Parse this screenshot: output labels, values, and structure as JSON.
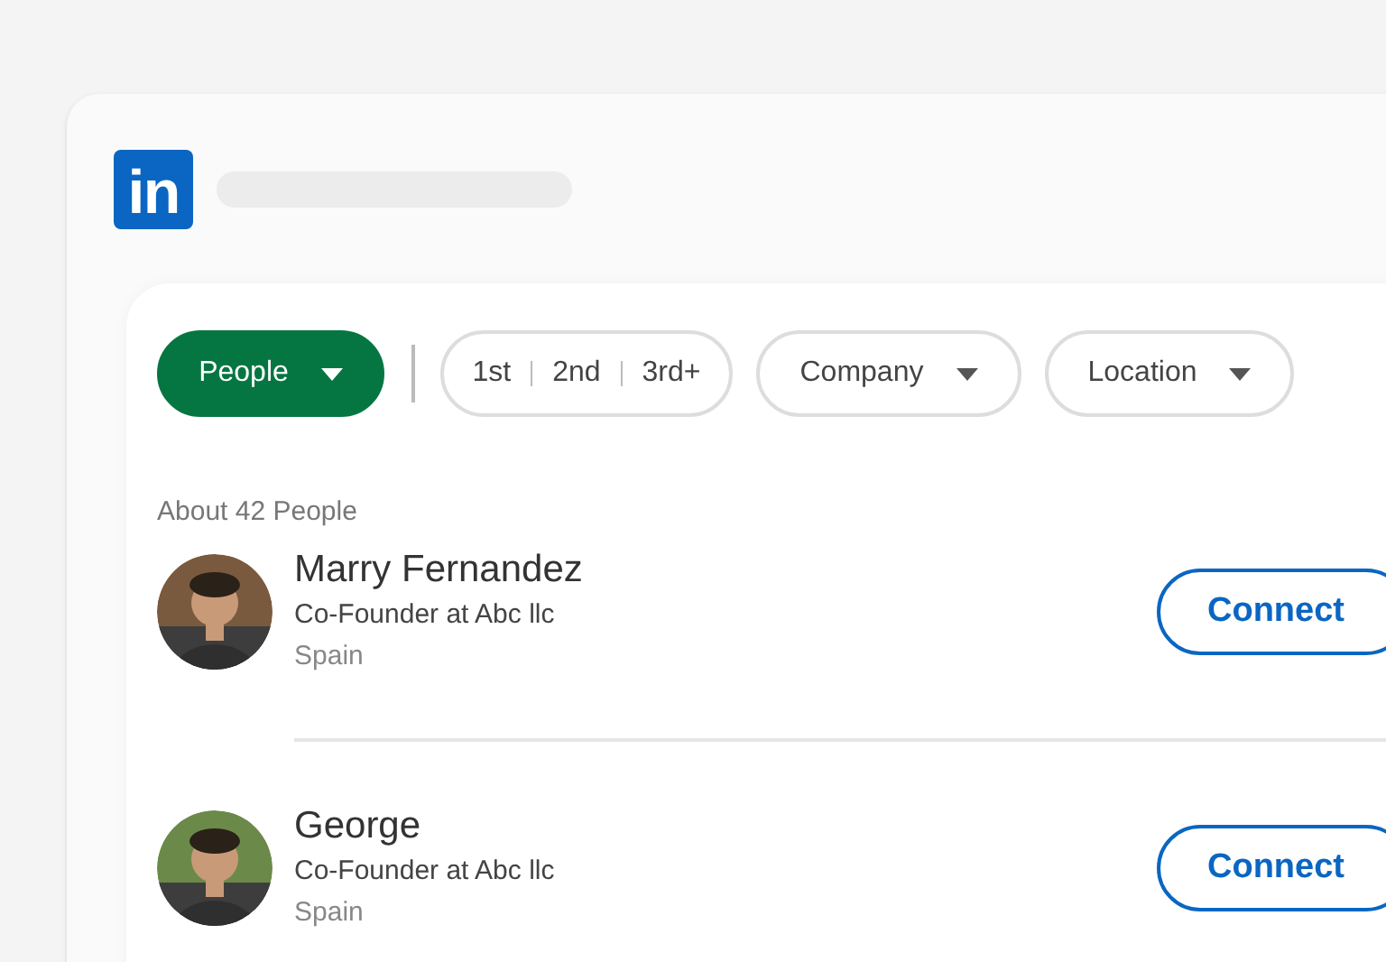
{
  "logo": {
    "text": "in"
  },
  "filters": [
    {
      "kind": "dropdown",
      "label": "People",
      "selected": true
    },
    {
      "kind": "degrees",
      "options": [
        "1st",
        "2nd",
        "3rd+"
      ]
    },
    {
      "kind": "dropdown",
      "label": "Company",
      "selected": false
    },
    {
      "kind": "dropdown",
      "label": "Location",
      "selected": false
    }
  ],
  "result_count": "About 42 People",
  "people": [
    {
      "name": "Marry Fernandez",
      "headline": "Co-Founder at Abc llc",
      "location": "Spain",
      "action": "Connect"
    },
    {
      "name": "George",
      "headline": "Co-Founder at Abc llc",
      "location": "Spain",
      "action": "Connect"
    }
  ]
}
